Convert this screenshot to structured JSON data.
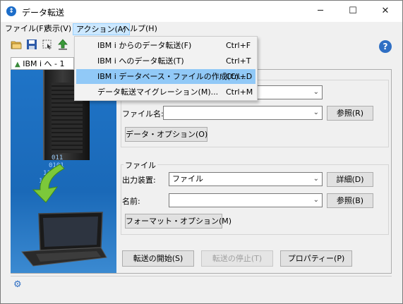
{
  "window": {
    "title": "データ転送",
    "app_icon": "app-icon",
    "controls": {
      "minimize": "─",
      "maximize": "☐",
      "close": "✕"
    }
  },
  "menubar": {
    "items": [
      {
        "label": "ファイル(F)"
      },
      {
        "label": "表示(V)"
      },
      {
        "label": "アクション(A)"
      },
      {
        "label": "ヘルプ(H)"
      }
    ]
  },
  "toolbar": {
    "icons": [
      "open-folder-icon",
      "save-icon",
      "select-icon",
      "upload-icon"
    ],
    "help": "?"
  },
  "tab": {
    "label": "IBM i へ - 1",
    "icon": "▲"
  },
  "action_menu": {
    "items": [
      {
        "label": "IBM i からのデータ転送(F)",
        "shortcut": "Ctrl+F"
      },
      {
        "label": "IBM i へのデータ転送(T)",
        "shortcut": "Ctrl+T"
      },
      {
        "label": "IBM i データベース・ファイルの作成(C)...",
        "shortcut": "Ctrl+D"
      },
      {
        "label": "データ転送マイグレーション(M)...",
        "shortcut": "Ctrl+M"
      }
    ],
    "highlighted": 2
  },
  "source_section": {
    "file_name_label": "ファイル名:",
    "file_name_value": "",
    "browse_button": "参照(R)",
    "data_options_button": "データ・オプション(O)"
  },
  "file_section": {
    "group_label": "ファイル",
    "output_device_label": "出力装置:",
    "output_device_value": "ファイル",
    "details_button": "詳細(D)",
    "name_label": "名前:",
    "name_value": "",
    "browse_button": "参照(B)",
    "format_options_button": "フォーマット・オプション(M)"
  },
  "actions": {
    "start_transfer": "転送の開始(S)",
    "stop_transfer": "転送の停止(T)",
    "properties": "プロパティー(P)"
  },
  "image": {
    "bits": [
      "011",
      "0101",
      "110",
      "101"
    ]
  },
  "colors": {
    "accent": "#1c6dc9",
    "menu_highlight": "#91c9f7",
    "side_panel": "#1f74c7"
  }
}
